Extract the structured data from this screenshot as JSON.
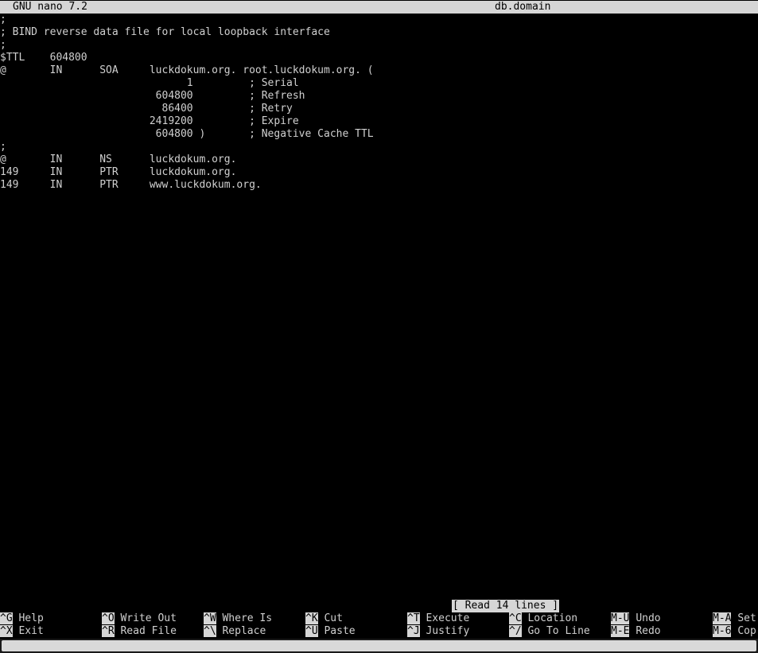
{
  "titlebar": {
    "app": "GNU nano 7.2",
    "file": "db.domain"
  },
  "editor": {
    "lines": [
      ";",
      "; BIND reverse data file for local loopback interface",
      ";",
      "$TTL    604800",
      "@       IN      SOA     luckdokum.org. root.luckdokum.org. (",
      "                              1         ; Serial",
      "                         604800         ; Refresh",
      "                          86400         ; Retry",
      "                        2419200         ; Expire",
      "                         604800 )       ; Negative Cache TTL",
      ";",
      "@       IN      NS      luckdokum.org.",
      "149     IN      PTR     luckdokum.org.",
      "149     IN      PTR     www.luckdokum.org."
    ]
  },
  "status": {
    "message": "[ Read 14 lines ]"
  },
  "shortcuts": {
    "row1": [
      {
        "key": "^G",
        "label": "Help"
      },
      {
        "key": "^O",
        "label": "Write Out"
      },
      {
        "key": "^W",
        "label": "Where Is"
      },
      {
        "key": "^K",
        "label": "Cut"
      },
      {
        "key": "^T",
        "label": "Execute"
      },
      {
        "key": "^C",
        "label": "Location"
      },
      {
        "key": "M-U",
        "label": "Undo"
      },
      {
        "key": "M-A",
        "label": "Set"
      }
    ],
    "row2": [
      {
        "key": "^X",
        "label": "Exit"
      },
      {
        "key": "^R",
        "label": "Read File"
      },
      {
        "key": "^\\",
        "label": "Replace"
      },
      {
        "key": "^U",
        "label": "Paste"
      },
      {
        "key": "^J",
        "label": "Justify"
      },
      {
        "key": "^/",
        "label": "Go To Line"
      },
      {
        "key": "M-E",
        "label": "Redo"
      },
      {
        "key": "M-6",
        "label": "Cop"
      }
    ]
  }
}
